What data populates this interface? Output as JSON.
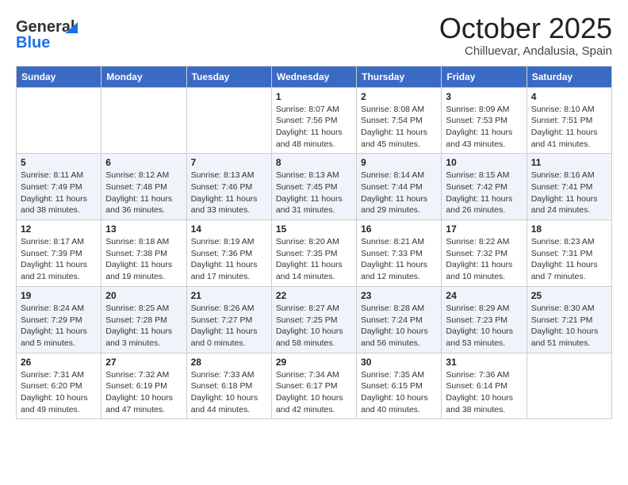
{
  "header": {
    "logo_line1": "General",
    "logo_line2": "Blue",
    "month_title": "October 2025",
    "location": "Chilluevar, Andalusia, Spain"
  },
  "weekdays": [
    "Sunday",
    "Monday",
    "Tuesday",
    "Wednesday",
    "Thursday",
    "Friday",
    "Saturday"
  ],
  "weeks": [
    [
      {
        "day": "",
        "sunrise": "",
        "sunset": "",
        "daylight": ""
      },
      {
        "day": "",
        "sunrise": "",
        "sunset": "",
        "daylight": ""
      },
      {
        "day": "",
        "sunrise": "",
        "sunset": "",
        "daylight": ""
      },
      {
        "day": "1",
        "sunrise": "Sunrise: 8:07 AM",
        "sunset": "Sunset: 7:56 PM",
        "daylight": "Daylight: 11 hours and 48 minutes."
      },
      {
        "day": "2",
        "sunrise": "Sunrise: 8:08 AM",
        "sunset": "Sunset: 7:54 PM",
        "daylight": "Daylight: 11 hours and 45 minutes."
      },
      {
        "day": "3",
        "sunrise": "Sunrise: 8:09 AM",
        "sunset": "Sunset: 7:53 PM",
        "daylight": "Daylight: 11 hours and 43 minutes."
      },
      {
        "day": "4",
        "sunrise": "Sunrise: 8:10 AM",
        "sunset": "Sunset: 7:51 PM",
        "daylight": "Daylight: 11 hours and 41 minutes."
      }
    ],
    [
      {
        "day": "5",
        "sunrise": "Sunrise: 8:11 AM",
        "sunset": "Sunset: 7:49 PM",
        "daylight": "Daylight: 11 hours and 38 minutes."
      },
      {
        "day": "6",
        "sunrise": "Sunrise: 8:12 AM",
        "sunset": "Sunset: 7:48 PM",
        "daylight": "Daylight: 11 hours and 36 minutes."
      },
      {
        "day": "7",
        "sunrise": "Sunrise: 8:13 AM",
        "sunset": "Sunset: 7:46 PM",
        "daylight": "Daylight: 11 hours and 33 minutes."
      },
      {
        "day": "8",
        "sunrise": "Sunrise: 8:13 AM",
        "sunset": "Sunset: 7:45 PM",
        "daylight": "Daylight: 11 hours and 31 minutes."
      },
      {
        "day": "9",
        "sunrise": "Sunrise: 8:14 AM",
        "sunset": "Sunset: 7:44 PM",
        "daylight": "Daylight: 11 hours and 29 minutes."
      },
      {
        "day": "10",
        "sunrise": "Sunrise: 8:15 AM",
        "sunset": "Sunset: 7:42 PM",
        "daylight": "Daylight: 11 hours and 26 minutes."
      },
      {
        "day": "11",
        "sunrise": "Sunrise: 8:16 AM",
        "sunset": "Sunset: 7:41 PM",
        "daylight": "Daylight: 11 hours and 24 minutes."
      }
    ],
    [
      {
        "day": "12",
        "sunrise": "Sunrise: 8:17 AM",
        "sunset": "Sunset: 7:39 PM",
        "daylight": "Daylight: 11 hours and 21 minutes."
      },
      {
        "day": "13",
        "sunrise": "Sunrise: 8:18 AM",
        "sunset": "Sunset: 7:38 PM",
        "daylight": "Daylight: 11 hours and 19 minutes."
      },
      {
        "day": "14",
        "sunrise": "Sunrise: 8:19 AM",
        "sunset": "Sunset: 7:36 PM",
        "daylight": "Daylight: 11 hours and 17 minutes."
      },
      {
        "day": "15",
        "sunrise": "Sunrise: 8:20 AM",
        "sunset": "Sunset: 7:35 PM",
        "daylight": "Daylight: 11 hours and 14 minutes."
      },
      {
        "day": "16",
        "sunrise": "Sunrise: 8:21 AM",
        "sunset": "Sunset: 7:33 PM",
        "daylight": "Daylight: 11 hours and 12 minutes."
      },
      {
        "day": "17",
        "sunrise": "Sunrise: 8:22 AM",
        "sunset": "Sunset: 7:32 PM",
        "daylight": "Daylight: 11 hours and 10 minutes."
      },
      {
        "day": "18",
        "sunrise": "Sunrise: 8:23 AM",
        "sunset": "Sunset: 7:31 PM",
        "daylight": "Daylight: 11 hours and 7 minutes."
      }
    ],
    [
      {
        "day": "19",
        "sunrise": "Sunrise: 8:24 AM",
        "sunset": "Sunset: 7:29 PM",
        "daylight": "Daylight: 11 hours and 5 minutes."
      },
      {
        "day": "20",
        "sunrise": "Sunrise: 8:25 AM",
        "sunset": "Sunset: 7:28 PM",
        "daylight": "Daylight: 11 hours and 3 minutes."
      },
      {
        "day": "21",
        "sunrise": "Sunrise: 8:26 AM",
        "sunset": "Sunset: 7:27 PM",
        "daylight": "Daylight: 11 hours and 0 minutes."
      },
      {
        "day": "22",
        "sunrise": "Sunrise: 8:27 AM",
        "sunset": "Sunset: 7:25 PM",
        "daylight": "Daylight: 10 hours and 58 minutes."
      },
      {
        "day": "23",
        "sunrise": "Sunrise: 8:28 AM",
        "sunset": "Sunset: 7:24 PM",
        "daylight": "Daylight: 10 hours and 56 minutes."
      },
      {
        "day": "24",
        "sunrise": "Sunrise: 8:29 AM",
        "sunset": "Sunset: 7:23 PM",
        "daylight": "Daylight: 10 hours and 53 minutes."
      },
      {
        "day": "25",
        "sunrise": "Sunrise: 8:30 AM",
        "sunset": "Sunset: 7:21 PM",
        "daylight": "Daylight: 10 hours and 51 minutes."
      }
    ],
    [
      {
        "day": "26",
        "sunrise": "Sunrise: 7:31 AM",
        "sunset": "Sunset: 6:20 PM",
        "daylight": "Daylight: 10 hours and 49 minutes."
      },
      {
        "day": "27",
        "sunrise": "Sunrise: 7:32 AM",
        "sunset": "Sunset: 6:19 PM",
        "daylight": "Daylight: 10 hours and 47 minutes."
      },
      {
        "day": "28",
        "sunrise": "Sunrise: 7:33 AM",
        "sunset": "Sunset: 6:18 PM",
        "daylight": "Daylight: 10 hours and 44 minutes."
      },
      {
        "day": "29",
        "sunrise": "Sunrise: 7:34 AM",
        "sunset": "Sunset: 6:17 PM",
        "daylight": "Daylight: 10 hours and 42 minutes."
      },
      {
        "day": "30",
        "sunrise": "Sunrise: 7:35 AM",
        "sunset": "Sunset: 6:15 PM",
        "daylight": "Daylight: 10 hours and 40 minutes."
      },
      {
        "day": "31",
        "sunrise": "Sunrise: 7:36 AM",
        "sunset": "Sunset: 6:14 PM",
        "daylight": "Daylight: 10 hours and 38 minutes."
      },
      {
        "day": "",
        "sunrise": "",
        "sunset": "",
        "daylight": ""
      }
    ]
  ]
}
